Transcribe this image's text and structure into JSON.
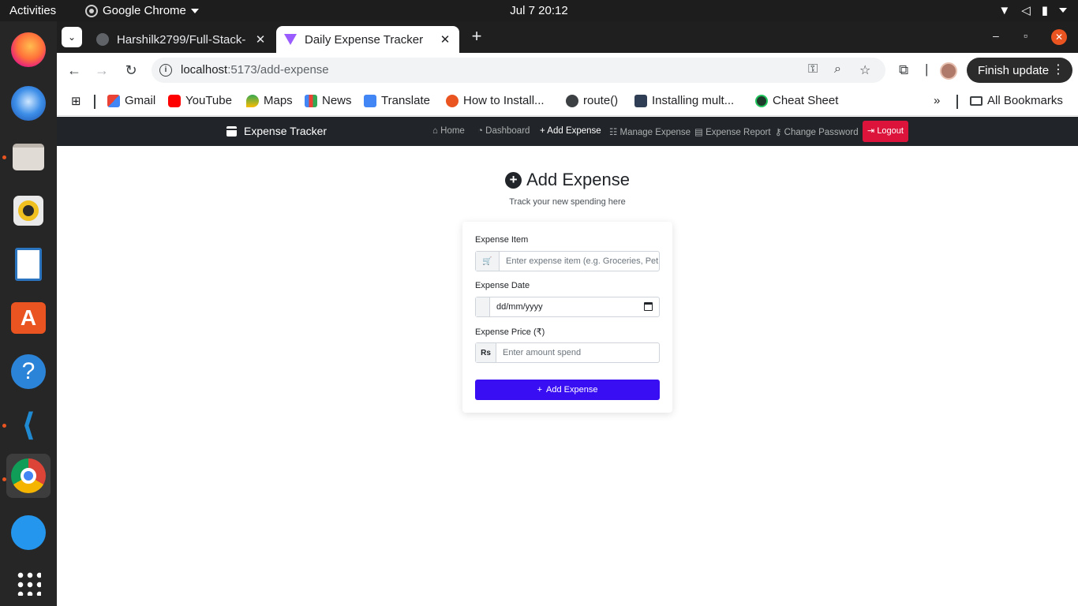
{
  "system": {
    "activities": "Activities",
    "app_name": "Google Chrome",
    "clock": "Jul 7  20:12"
  },
  "dock": [
    "firefox-icon",
    "thunderbird-icon",
    "files-icon",
    "rhythmbox-icon",
    "writer-icon",
    "app-center-icon",
    "help-icon",
    "vscode-icon",
    "chrome-icon",
    "docker-icon",
    "app-grid-icon"
  ],
  "browser": {
    "tabs": [
      {
        "title": "Harshilk2799/Full-Stack-"
      },
      {
        "title": "Daily Expense Tracker"
      }
    ],
    "url_host": "localhost",
    "url_path": ":5173/add-expense",
    "update_button": "Finish update",
    "bookmarks": [
      "Gmail",
      "YouTube",
      "Maps",
      "News",
      "Translate",
      "How to Install...",
      "route()",
      "Installing mult...",
      "Cheat Sheet"
    ],
    "all_bookmarks": "All Bookmarks"
  },
  "app": {
    "brand": "Expense Tracker",
    "nav": {
      "home": "Home",
      "dashboard": "Dashboard",
      "add_expense": "Add Expense",
      "manage_expense": "Manage Expense",
      "expense_report": "Expense Report",
      "change_password": "Change Password",
      "logout": "Logout"
    },
    "heading": "Add Expense",
    "subtitle": "Track your new spending here",
    "form": {
      "item_label": "Expense Item",
      "item_placeholder": "Enter expense item (e.g. Groceries, Petrol)",
      "date_label": "Expense Date",
      "date_value": "dd/mm/yyyy",
      "price_label": "Expense Price (₹)",
      "price_addon": "Rs",
      "price_placeholder": "Enter amount spend",
      "submit": "Add Expense"
    }
  }
}
